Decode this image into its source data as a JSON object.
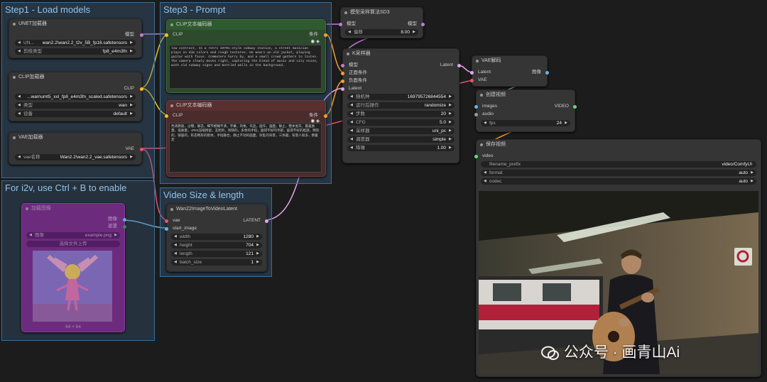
{
  "groups": {
    "step1": "Step1 - Load models",
    "step3": "Step3 - Prompt",
    "i2v": "For i2v, use Ctrl + B to enable",
    "video_size": "Video Size & length"
  },
  "unet_loader": {
    "title": "UNET加载器",
    "output": "模型",
    "unet_name_label": "UN...",
    "unet_name_value": "wan2.2\\wan2.2_t2v_5B_fp16.safetensors",
    "dtype_label": "剪枝类型",
    "dtype_value": "fp8_e4m3fn"
  },
  "clip_loader": {
    "title": "CLIP加载器",
    "output": "CLIP",
    "clip_name_value": "...wan\\umt5_xxl_fp8_e4m3fn_scaled.safetensors",
    "type_label": "类型",
    "type_value": "wan",
    "device_label": "设备",
    "device_value": "default"
  },
  "vae_loader": {
    "title": "VAE加载器",
    "output": "VAE",
    "vae_name_label": "vae名称",
    "vae_name_value": "Wan2.2\\wan2.2_vae.safetensors"
  },
  "pos_prompt": {
    "title": "CLIP文本编码器",
    "input": "CLIP",
    "output": "条件",
    "text": "low contrast, In a retro 1970s-style subway station, a street musician plays in dim colors and rough textures. He wears an old jacket, playing guitar with focus. Commuters hurry by, and a small crowd gathers to listen. The camera slowly moves right, capturing the blend of music and city noise, with old subway signs and mottled walls in the background."
  },
  "neg_prompt": {
    "title": "CLIP文本编码器",
    "input": "CLIP",
    "output": "条件",
    "text": "色调艳丽，过曝，静态，细节模糊不清，字幕，风格，作品，画作，画面，静止，整体发灰，最差质量，低质量，JPEG压缩残留，丑陋的，残缺的，多余的手指，画得不好的手部，画得不好的脸部，畸形的，毁容的，形态畸形的肢体，手指融合，静止不动的画面，杂乱的背景，三条腿，背景人很多，倒着走"
  },
  "model_sampling": {
    "title": "模型采样算法SD3",
    "input": "模型",
    "output": "模型",
    "shift_label": "偏移",
    "shift_value": "8.00"
  },
  "ksampler": {
    "title": "K采样器",
    "inputs": [
      "模型",
      "正面条件",
      "负面条件",
      "Latent"
    ],
    "output": "Latent",
    "widgets": [
      {
        "label": "随机种",
        "value": "169795726844554"
      },
      {
        "label": "运行后操作",
        "value": "randomize"
      },
      {
        "label": "步数",
        "value": "20"
      },
      {
        "label": "CFG",
        "value": "5.0"
      },
      {
        "label": "采样器",
        "value": "uni_pc"
      },
      {
        "label": "调度器",
        "value": "simple"
      },
      {
        "label": "降噪",
        "value": "1.00"
      }
    ]
  },
  "vae_decode": {
    "title": "VAE解码",
    "inputs": [
      "Latent",
      "VAE"
    ],
    "output": "图像"
  },
  "create_video": {
    "title": "创建视频",
    "inputs": [
      "images",
      "audio"
    ],
    "output": "VIDEO",
    "fps_label": "fps",
    "fps_value": "24"
  },
  "save_video": {
    "title": "保存视频",
    "input": "video",
    "filename_label": "filename_prefix",
    "filename_value": "video/ComfyUI",
    "format_label": "format",
    "format_value": "auto",
    "codec_label": "codec",
    "codec_value": "auto"
  },
  "load_image": {
    "title": "加载图像",
    "outputs": [
      "图像",
      "遮罩"
    ],
    "image_label": "图像",
    "image_value": "example.png",
    "upload_label": "选择文件上传",
    "size_label": "64 × 64"
  },
  "wan_latent": {
    "title": "Wan22ImageToVideoLatent",
    "inputs": [
      "vae",
      "start_image"
    ],
    "output": "LATENT",
    "widgets": [
      {
        "label": "width",
        "value": "1280"
      },
      {
        "label": "height",
        "value": "704"
      },
      {
        "label": "length",
        "value": "121"
      },
      {
        "label": "batch_size",
        "value": "1"
      }
    ]
  },
  "watermark": "公众号 · 画青山Ai",
  "colors": {
    "group_title": "#8fc4ea",
    "clip_wire": "#f5c518",
    "model_wire": "#c37bd6",
    "vae_wire": "#f0506e",
    "latent_wire": "#e3a6f0",
    "image_wire": "#67b5e8"
  }
}
